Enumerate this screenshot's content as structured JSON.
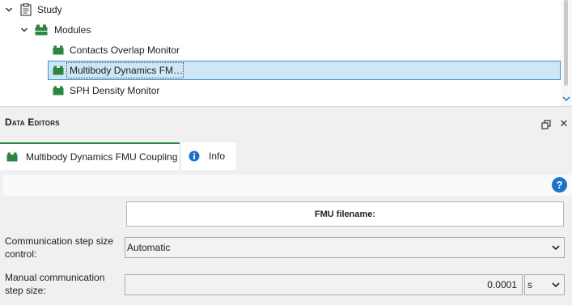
{
  "tree": {
    "items": [
      {
        "label": "Study",
        "icon": "clipboard-icon",
        "expanded": true
      },
      {
        "label": "Modules",
        "icon": "modules-icon",
        "expanded": true
      },
      {
        "label": "Contacts Overlap Monitor",
        "icon": "module-icon"
      },
      {
        "label": "Multibody Dynamics FM…",
        "icon": "module-icon",
        "selected": true
      },
      {
        "label": "SPH Density Monitor",
        "icon": "module-icon"
      }
    ]
  },
  "data_editors": {
    "title": "Data Editors"
  },
  "tabs": [
    {
      "label": "Multibody Dynamics FMU Coupling",
      "icon": "module-icon",
      "active": true
    },
    {
      "label": "Info",
      "icon": "info-icon",
      "active": false
    }
  ],
  "form": {
    "help_label": "?",
    "fmu_button_label": "FMU filename:",
    "step_control": {
      "label": "Communication step size control:",
      "value": "Automatic"
    },
    "manual_step": {
      "label": "Manual communication step size:",
      "value": "0.0001",
      "unit": "s"
    }
  },
  "colors": {
    "accent_green": "#2e8540",
    "selection_bg": "#cfe6f6",
    "selection_border": "#3c8fd0",
    "help_blue": "#1e73c8"
  }
}
